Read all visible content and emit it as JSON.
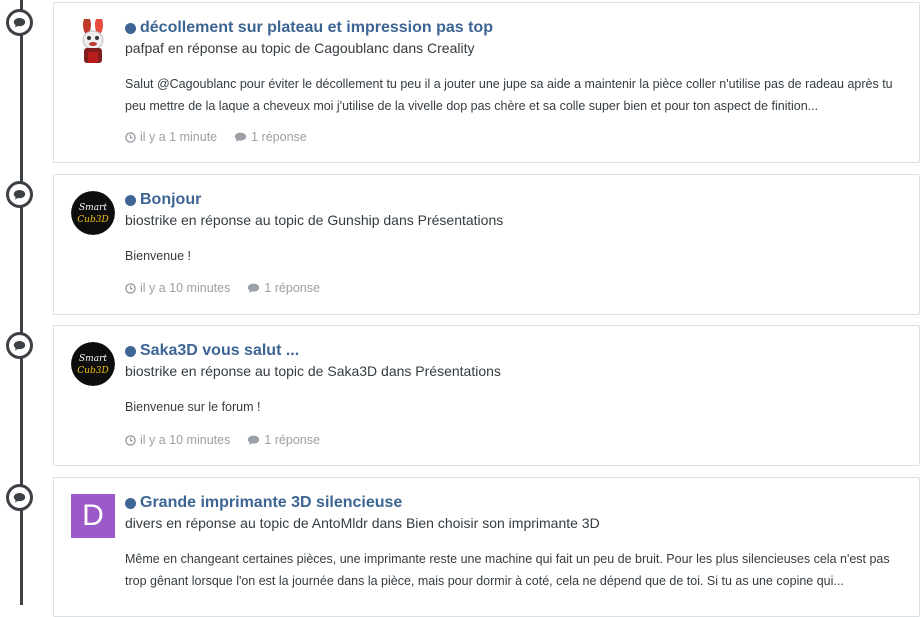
{
  "posts": [
    {
      "title": "décollement sur plateau et impression pas top",
      "meta": "pafpaf en réponse au topic de Cagoublanc dans Creality",
      "snippet": "Salut @Cagoublanc pour éviter le décollement tu peu il a jouter une jupe sa aide a maintenir la pièce coller n'utilise pas de radeau après tu peu mettre de la laque a cheveux moi j'utilise de la vivelle dop pas chère et sa colle super bien et pour ton aspect de finition...",
      "time": "il y a 1 minute",
      "replies": "1 réponse",
      "avatar": "rabbid-avatar"
    },
    {
      "title": "Bonjour",
      "meta": "biostrike en réponse au topic de Gunship dans Présentations",
      "snippet": "Bienvenue !",
      "time": "il y a 10 minutes",
      "replies": "1 réponse",
      "avatar": "smartcub3d-logo",
      "avatar_text": [
        "Smart",
        "Cub3D"
      ]
    },
    {
      "title": "Saka3D vous salut ...",
      "meta": "biostrike en réponse au topic de Saka3D dans Présentations",
      "snippet": "Bienvenue sur le forum !",
      "time": "il y a 10 minutes",
      "replies": "1 réponse",
      "avatar": "smartcub3d-logo",
      "avatar_text": [
        "Smart",
        "Cub3D"
      ]
    },
    {
      "title": "Grande imprimante 3D silencieuse",
      "meta": "divers en réponse au topic de AntoMldr dans Bien choisir son imprimante 3D",
      "snippet": "Même en changeant certaines pièces, une imprimante reste une machine qui fait un peu de bruit. Pour les plus silencieuses cela n'est pas trop gênant lorsque l'on est la journée dans la pièce, mais pour dormir à coté, cela ne dépend que de toi. Si tu as une copine qui...",
      "avatar_letter": "D",
      "avatar_color": "#9b59c9"
    }
  ],
  "colors": {
    "accent": "#3d6594",
    "timeline": "#3d4045",
    "muted": "#9aa0a6"
  }
}
